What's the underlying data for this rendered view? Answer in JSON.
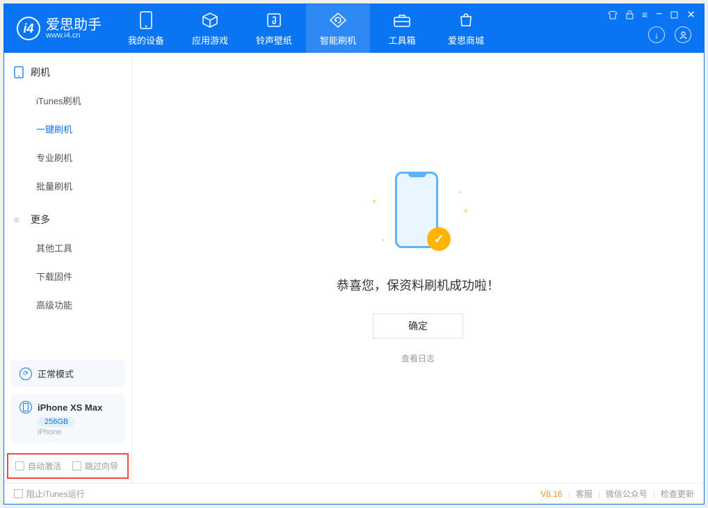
{
  "app": {
    "name_cn": "爱思助手",
    "url": "www.i4.cn",
    "logo_letter": "i4"
  },
  "nav": [
    {
      "label": "我的设备",
      "icon": "device"
    },
    {
      "label": "应用游戏",
      "icon": "cube"
    },
    {
      "label": "铃声壁纸",
      "icon": "music"
    },
    {
      "label": "智能刷机",
      "icon": "refresh",
      "active": true
    },
    {
      "label": "工具箱",
      "icon": "toolbox"
    },
    {
      "label": "爱思商城",
      "icon": "shop"
    }
  ],
  "sidebar": {
    "section1": {
      "title": "刷机",
      "items": [
        "iTunes刷机",
        "一键刷机",
        "专业刷机",
        "批量刷机"
      ],
      "active_index": 1
    },
    "section2": {
      "title": "更多",
      "items": [
        "其他工具",
        "下载固件",
        "高级功能"
      ]
    }
  },
  "device_panel": {
    "mode": "正常模式",
    "name": "iPhone XS Max",
    "storage": "256GB",
    "type": "iPhone"
  },
  "checkboxes": {
    "auto_activate": "自动激活",
    "skip_guide": "跳过向导"
  },
  "main": {
    "success_text": "恭喜您，保资料刷机成功啦！",
    "ok_button": "确定",
    "view_log": "查看日志"
  },
  "statusbar": {
    "block_itunes": "阻止iTunes运行",
    "version": "V8.16",
    "links": [
      "客服",
      "微信公众号",
      "检查更新"
    ]
  }
}
